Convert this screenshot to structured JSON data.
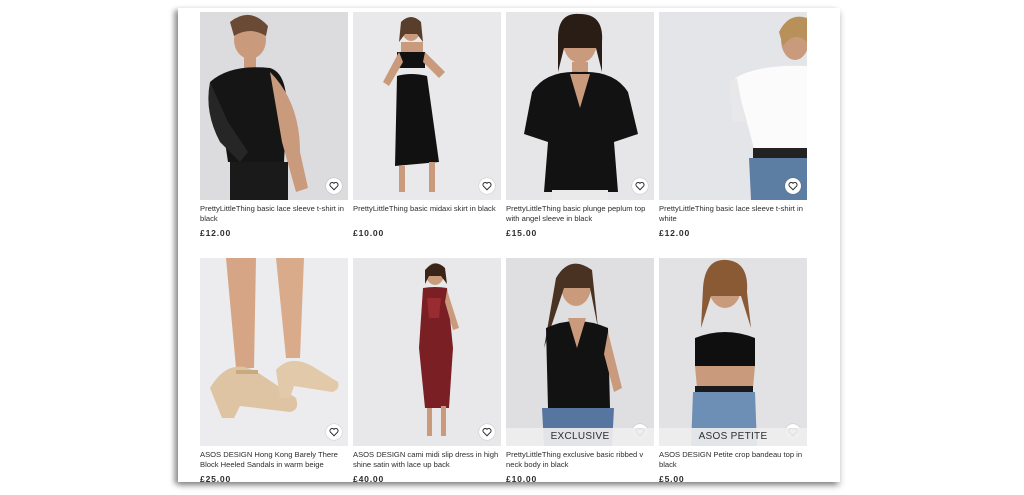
{
  "products": [
    {
      "title": "PrettyLittleThing basic lace sleeve t-shirt in black",
      "price": "£12.00",
      "image": "woman-black-lace-tshirt",
      "background": "#dcdcde",
      "badge": ""
    },
    {
      "title": "PrettyLittleThing basic midaxi skirt in black",
      "price": "£10.00",
      "image": "woman-black-midaxi-skirt",
      "background": "#e9e9eb",
      "badge": ""
    },
    {
      "title": "PrettyLittleThing basic plunge peplum top with angel sleeve in black",
      "price": "£15.00",
      "image": "woman-black-peplum-top",
      "background": "#e6e6e8",
      "badge": ""
    },
    {
      "title": "PrettyLittleThing basic lace sleeve t-shirt in white",
      "price": "£12.00",
      "image": "woman-white-lace-tshirt",
      "background": "#e4e5e8",
      "badge": ""
    },
    {
      "title": "ASOS DESIGN Hong Kong Barely There Block Heeled Sandals in warm beige",
      "price": "£25.00",
      "image": "beige-block-heel-sandals",
      "background": "#ececee",
      "badge": ""
    },
    {
      "title": "ASOS DESIGN cami midi slip dress in high shine satin with lace up back",
      "price": "£40.00",
      "image": "woman-burgundy-satin-dress",
      "background": "#e8e8ea",
      "badge": ""
    },
    {
      "title": "PrettyLittleThing exclusive basic ribbed v neck body in black",
      "price": "£10.00",
      "image": "woman-black-ribbed-body",
      "background": "#dfdfe1",
      "badge": "EXCLUSIVE"
    },
    {
      "title": "ASOS DESIGN Petite crop bandeau top in black",
      "price": "£5.00",
      "image": "woman-black-bandeau-top",
      "background": "#e2e2e4",
      "badge": "ASOS PETITE"
    }
  ]
}
